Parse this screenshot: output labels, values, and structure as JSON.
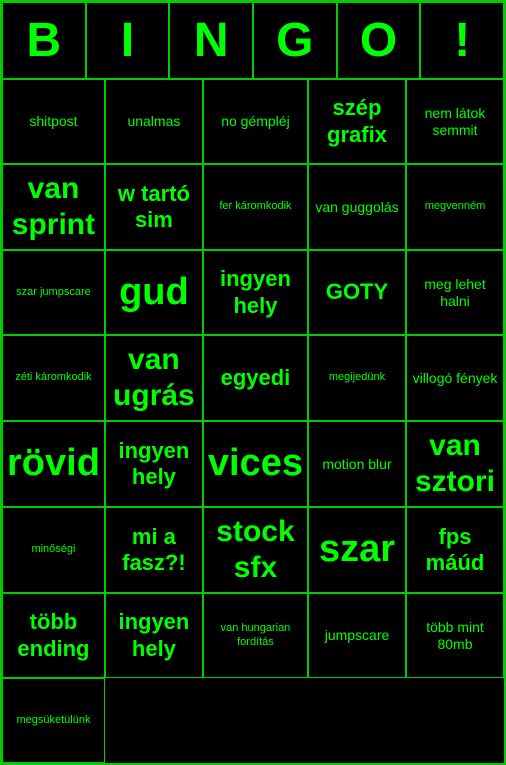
{
  "header": {
    "letters": [
      "B",
      "I",
      "N",
      "G",
      "O",
      "!"
    ]
  },
  "cells": [
    {
      "text": "shitpost",
      "size": "medium"
    },
    {
      "text": "unalmas",
      "size": "medium"
    },
    {
      "text": "no gémpléj",
      "size": "medium"
    },
    {
      "text": "szép grafix",
      "size": "large"
    },
    {
      "text": "nem látok semmit",
      "size": "medium"
    },
    {
      "text": "van sprint",
      "size": "xlarge"
    },
    {
      "text": "w tartó sim",
      "size": "large"
    },
    {
      "text": "fer káromkodik",
      "size": "small"
    },
    {
      "text": "van guggolás",
      "size": "medium"
    },
    {
      "text": "megvenném",
      "size": "small"
    },
    {
      "text": "szar jumpscare",
      "size": "small"
    },
    {
      "text": "gud",
      "size": "xxlarge"
    },
    {
      "text": "ingyen hely",
      "size": "large"
    },
    {
      "text": "GOTY",
      "size": "large"
    },
    {
      "text": "meg lehet halni",
      "size": "medium"
    },
    {
      "text": "zéti káromkodik",
      "size": "small"
    },
    {
      "text": "van ugrás",
      "size": "xlarge"
    },
    {
      "text": "egyedi",
      "size": "large"
    },
    {
      "text": "megijedünk",
      "size": "small"
    },
    {
      "text": "villogó fények",
      "size": "medium"
    },
    {
      "text": "rövid",
      "size": "xxlarge"
    },
    {
      "text": "ingyen hely",
      "size": "large"
    },
    {
      "text": "vices",
      "size": "xxlarge"
    },
    {
      "text": "motion blur",
      "size": "medium"
    },
    {
      "text": "van sztori",
      "size": "xlarge"
    },
    {
      "text": "minőségi",
      "size": "small"
    },
    {
      "text": "mi a fasz?!",
      "size": "large"
    },
    {
      "text": "stock sfx",
      "size": "xlarge"
    },
    {
      "text": "szar",
      "size": "xxlarge"
    },
    {
      "text": "fps máúd",
      "size": "large"
    },
    {
      "text": "több ending",
      "size": "large"
    },
    {
      "text": "ingyen hely",
      "size": "large"
    },
    {
      "text": "van hungarian fordítás",
      "size": "small"
    },
    {
      "text": "jumpscare",
      "size": "medium"
    },
    {
      "text": "több mint 80mb",
      "size": "medium"
    },
    {
      "text": "megsüketülünk",
      "size": "small"
    }
  ]
}
